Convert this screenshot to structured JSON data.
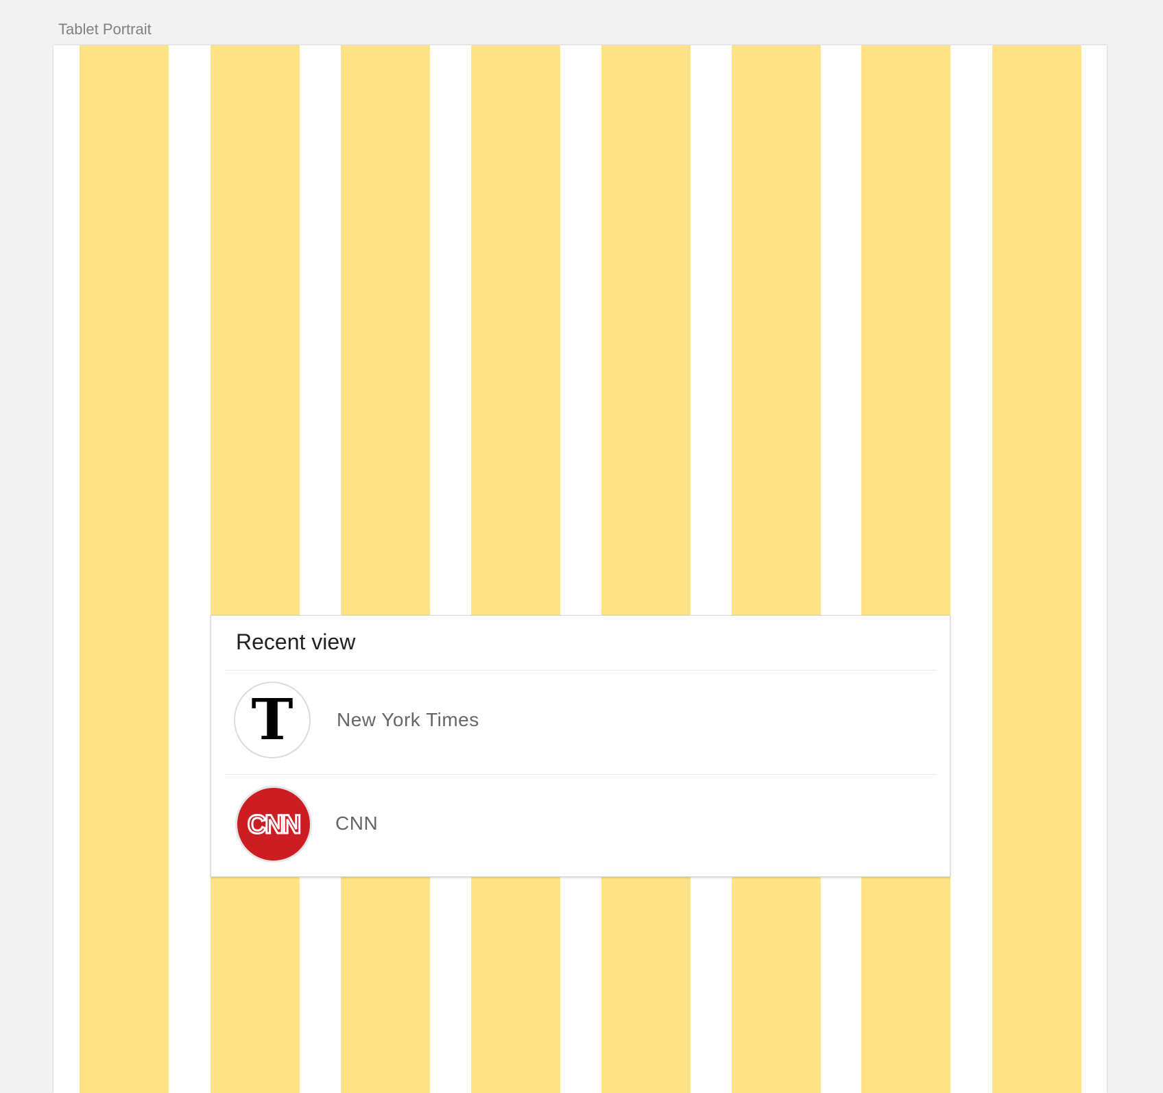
{
  "artboard": {
    "label": "Tablet Portrait",
    "grid_color": "#ffe186"
  },
  "recent_view": {
    "title": "Recent view",
    "items": [
      {
        "label": "New York Times",
        "logo": "nyt-logo-icon",
        "logo_text": "T"
      },
      {
        "label": "CNN",
        "logo": "cnn-logo-icon",
        "logo_text": "CNN",
        "logo_color": "#cc1d23"
      }
    ]
  }
}
